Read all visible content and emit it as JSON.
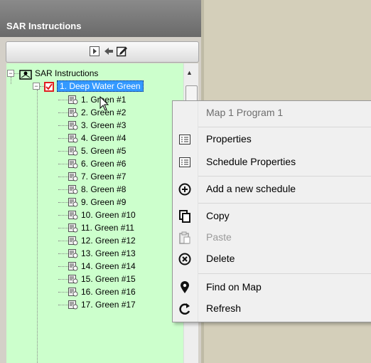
{
  "panel": {
    "title": "SAR Instructions"
  },
  "tree": {
    "root_label": "SAR Instructions",
    "program_label": "1. Deep Water Green",
    "items": [
      "1. Green #1",
      "2. Green #2",
      "3. Green #3",
      "4. Green #4",
      "5. Green #5",
      "6. Green #6",
      "7. Green #7",
      "8. Green #8",
      "9. Green #9",
      "10. Green #10",
      "11. Green #11",
      "12. Green #12",
      "13. Green #13",
      "14. Green #14",
      "15. Green #15",
      "16. Green #16",
      "17. Green #17"
    ]
  },
  "context_menu": {
    "header": "Map 1 Program 1",
    "properties": "Properties",
    "schedule_properties": "Schedule Properties",
    "add_schedule": "Add a new schedule",
    "copy": "Copy",
    "paste": "Paste",
    "delete": "Delete",
    "find_on_map": "Find on Map",
    "refresh": "Refresh"
  },
  "icons": {
    "toolbar": [
      "play-icon",
      "arrow-left-icon",
      "edit-icon"
    ],
    "menu": [
      "properties-icon",
      "schedule-properties-icon",
      "add-circle-icon",
      "copy-icon",
      "paste-icon",
      "delete-circle-icon",
      "map-pin-icon",
      "refresh-icon"
    ]
  },
  "colors": {
    "tree_bg": "#ccffcc",
    "selection": "#3399ff",
    "check_red": "#e02020"
  }
}
